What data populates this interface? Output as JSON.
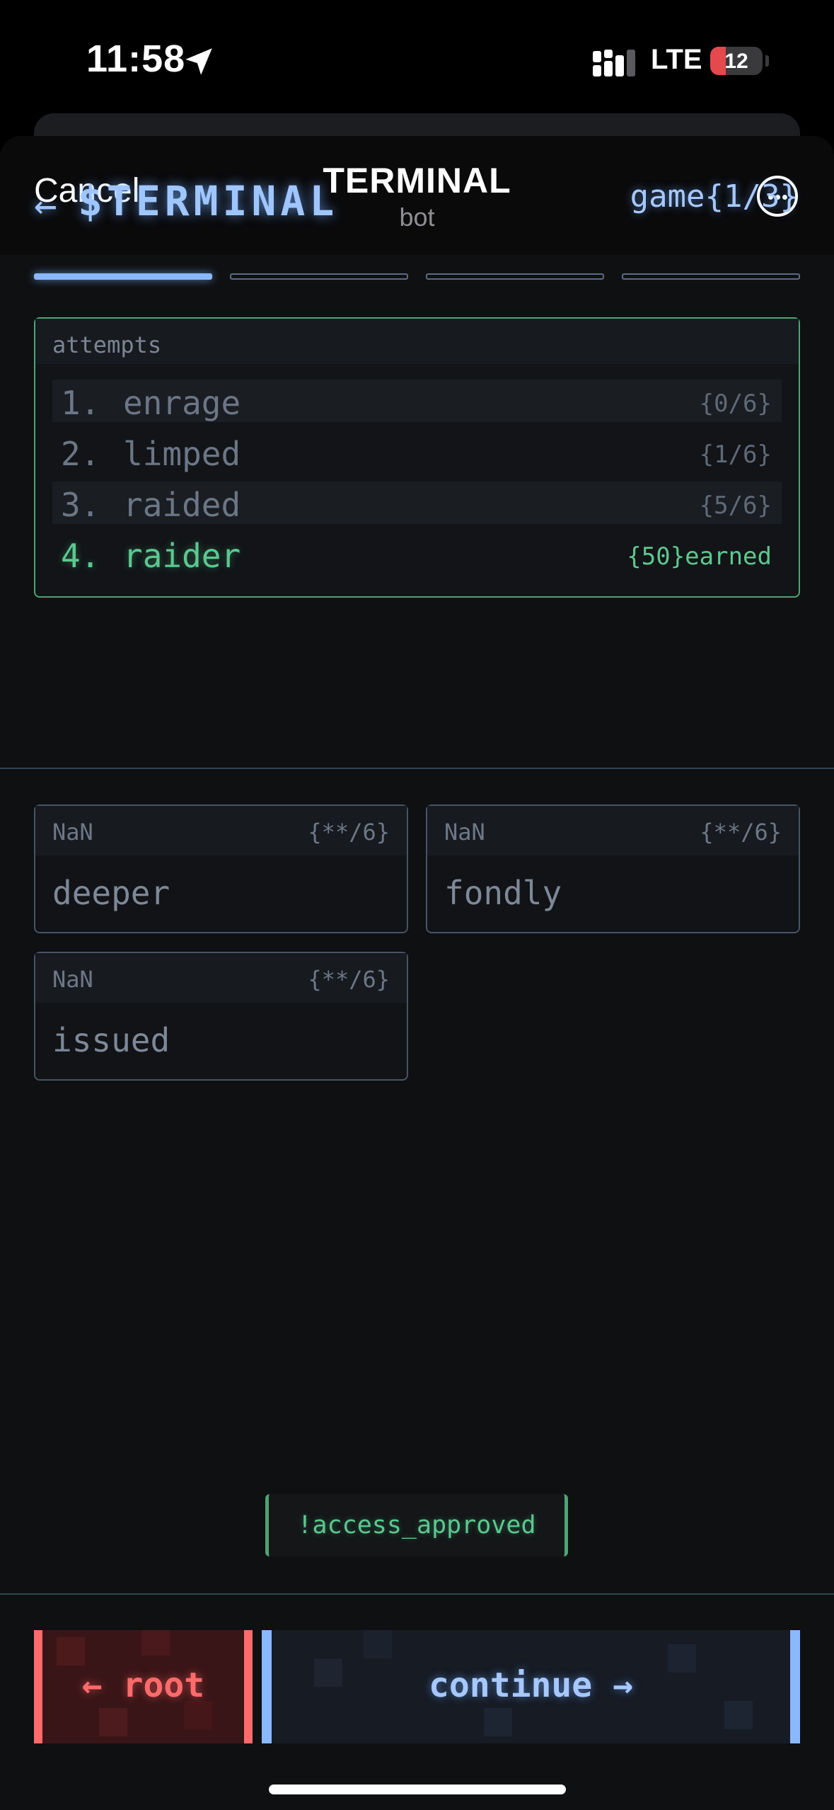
{
  "status_bar": {
    "time": "11:58",
    "network": "LTE",
    "battery": "12"
  },
  "nav": {
    "cancel": "Cancel",
    "title": "TERMINAL",
    "subtitle": "bot",
    "more_icon": "ellipsis-circle-icon"
  },
  "header": {
    "back_arrow": "←",
    "logo": "$TERMINAL",
    "game_counter": "game{1/3}"
  },
  "progress": {
    "active_step": 1,
    "total_steps": 4
  },
  "attempts": {
    "label": "attempts",
    "rows": [
      {
        "num": "1.",
        "word": "enrage",
        "score": "{0/6}"
      },
      {
        "num": "2.",
        "word": "limped",
        "score": "{1/6}"
      },
      {
        "num": "3.",
        "word": "raided",
        "score": "{5/6}"
      },
      {
        "num": "4.",
        "word": "raider",
        "score": "{50}earned"
      }
    ]
  },
  "guesses": [
    {
      "tag": "NaN",
      "score": "{**/6}",
      "word": "deeper"
    },
    {
      "tag": "NaN",
      "score": "{**/6}",
      "word": "fondly"
    },
    {
      "tag": "NaN",
      "score": "{**/6}",
      "word": "issued"
    }
  ],
  "toast": "!access_approved",
  "buttons": {
    "root": "← root",
    "continue": "continue →"
  },
  "colors": {
    "accent_blue": "#8ab8ff",
    "success_green": "#5cc88f",
    "danger_red": "#ff6b6b"
  }
}
